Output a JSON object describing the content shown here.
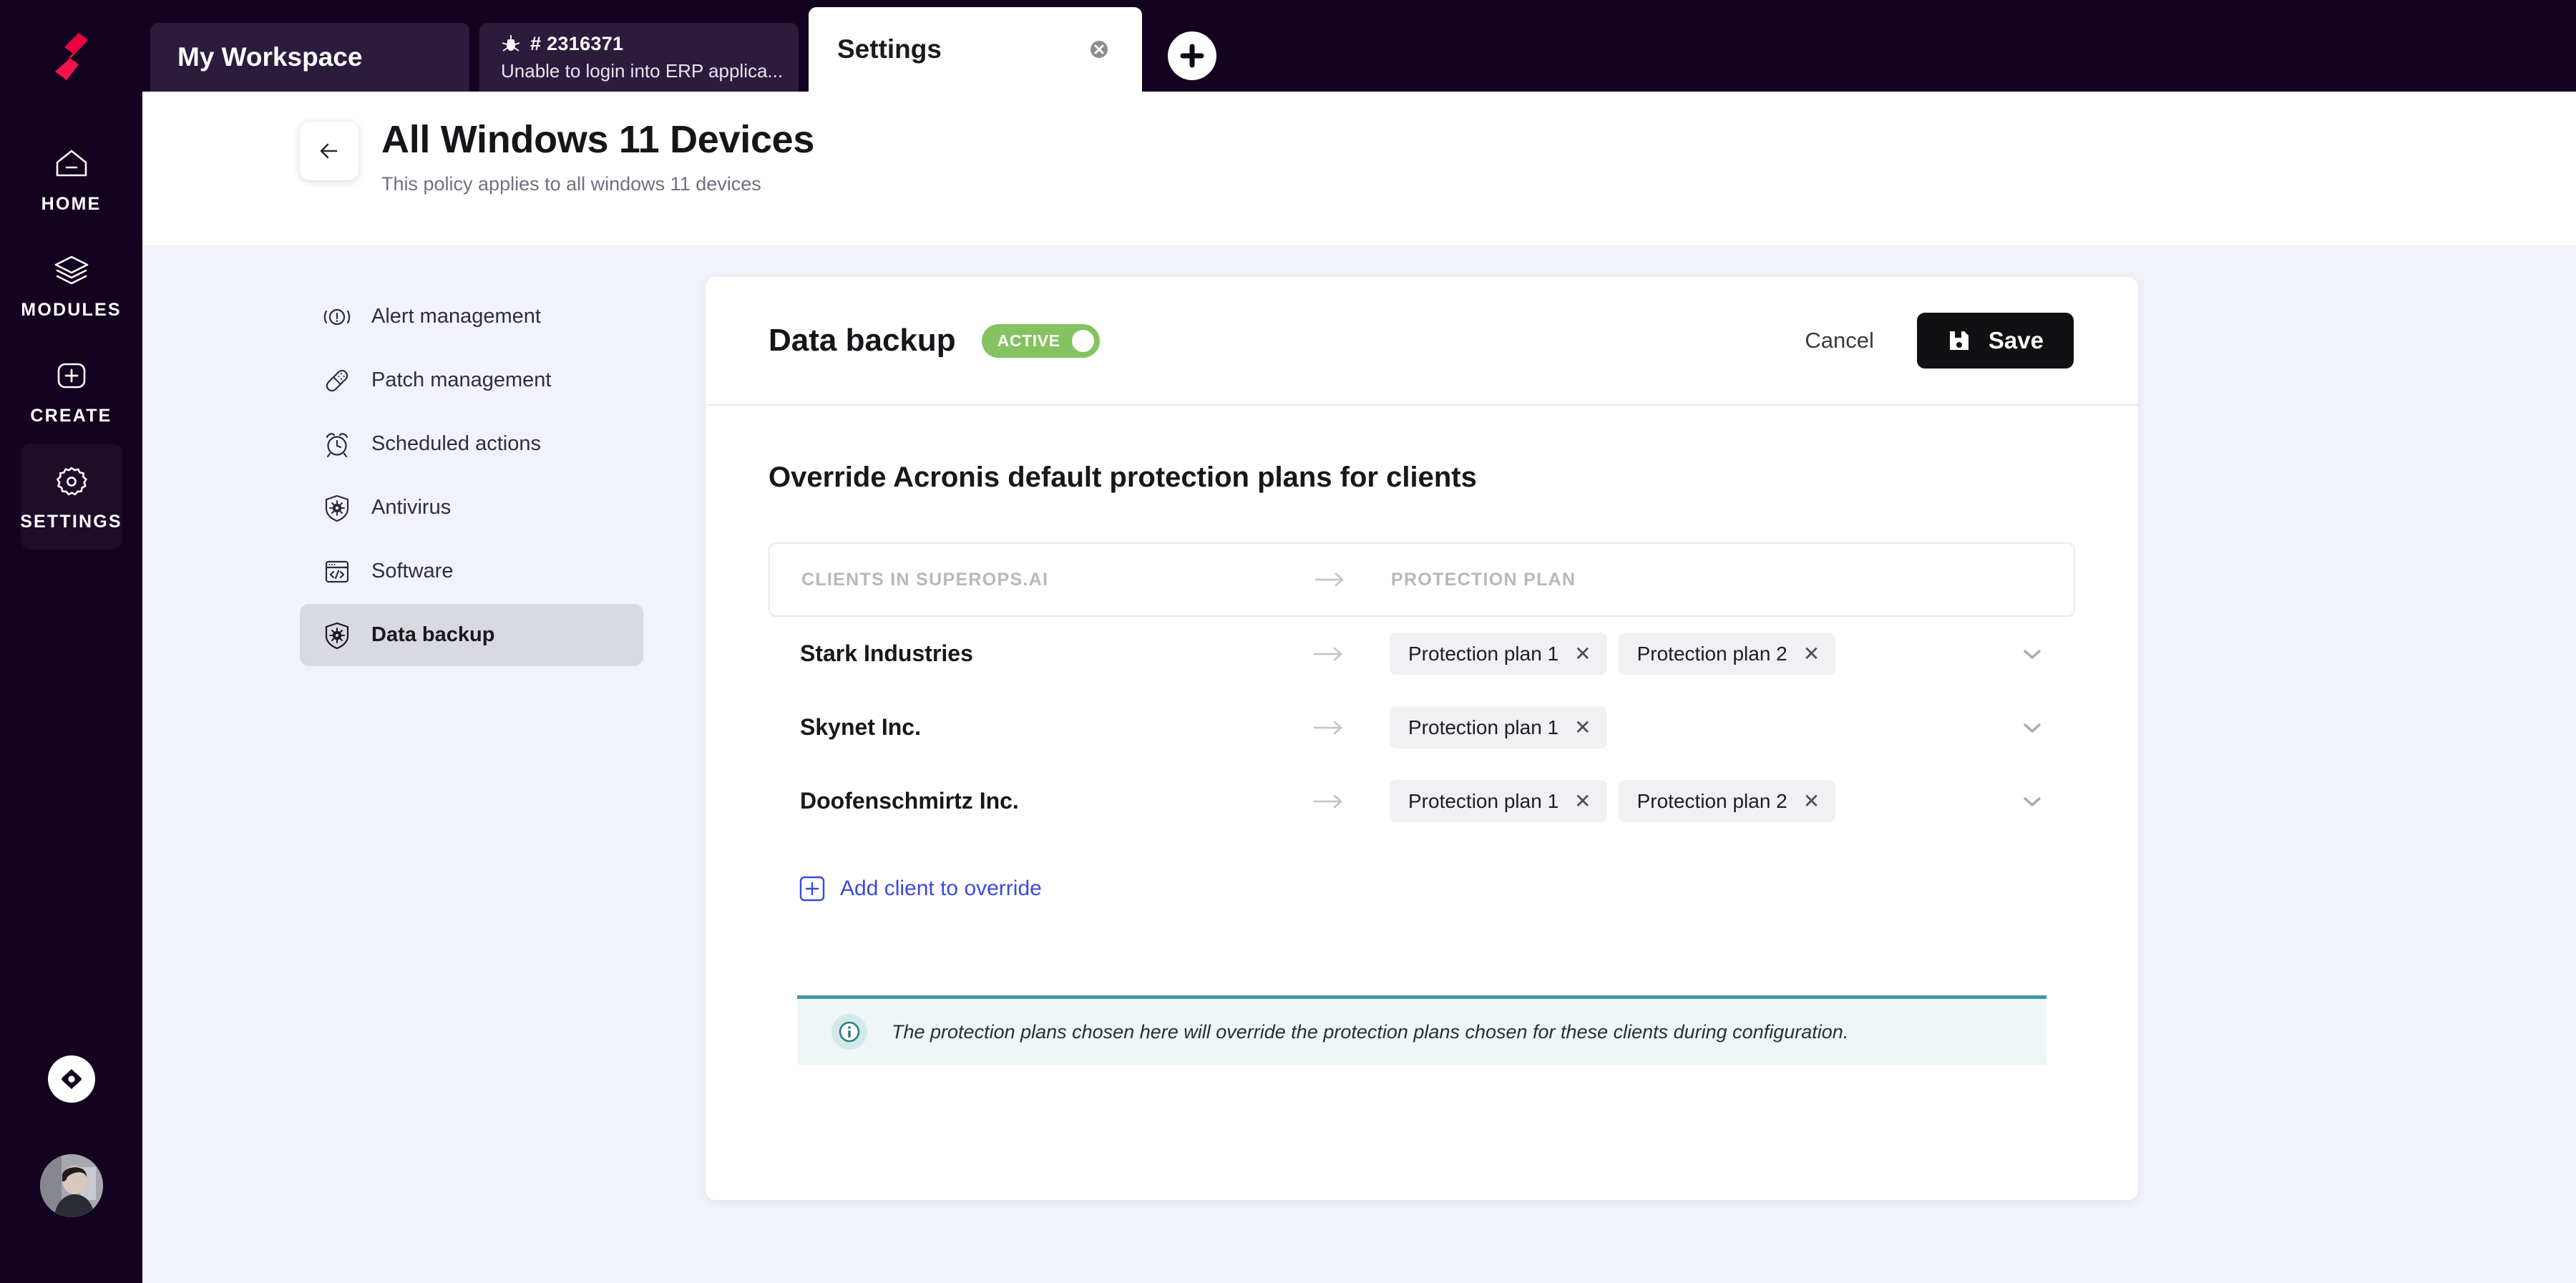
{
  "rail": {
    "logo_icon": "superops-logo-icon",
    "items": [
      {
        "label": "HOME",
        "icon": "home-icon",
        "active": false
      },
      {
        "label": "MODULES",
        "icon": "layers-icon",
        "active": false
      },
      {
        "label": "CREATE",
        "icon": "plus-square-icon",
        "active": false
      },
      {
        "label": "SETTINGS",
        "icon": "gear-icon",
        "active": true
      }
    ],
    "compass_icon": "compass-icon",
    "avatar_icon": "user-avatar"
  },
  "tabs": {
    "workspace": {
      "title": "My Workspace"
    },
    "ticket": {
      "icon": "bug-icon",
      "id": "# 2316371",
      "subject": "Unable to login into ERP applica..."
    },
    "settings": {
      "title": "Settings",
      "close_icon": "close-circle-icon"
    },
    "add_tab_icon": "plus-circle-icon"
  },
  "header": {
    "back_icon": "arrow-left-icon",
    "title": "All Windows 11 Devices",
    "subtitle": "This policy applies to all windows 11 devices"
  },
  "subnav": {
    "items": [
      {
        "label": "Alert management",
        "icon": "alert-circle-icon",
        "active": false
      },
      {
        "label": "Patch management",
        "icon": "bandage-icon",
        "active": false
      },
      {
        "label": "Scheduled actions",
        "icon": "alarm-clock-icon",
        "active": false
      },
      {
        "label": "Antivirus",
        "icon": "shield-virus-icon",
        "active": false
      },
      {
        "label": "Software",
        "icon": "code-window-icon",
        "active": false
      },
      {
        "label": "Data backup",
        "icon": "shield-virus-icon",
        "active": true
      }
    ]
  },
  "card": {
    "title": "Data backup",
    "status": {
      "label": "ACTIVE",
      "color": "#84c262"
    },
    "cancel_label": "Cancel",
    "save_label": "Save",
    "save_icon": "floppy-disk-icon",
    "section_title": "Override Acronis default protection plans for clients",
    "table": {
      "columns": [
        "CLIENTS IN SUPEROPS.AI",
        "PROTECTION PLAN"
      ],
      "arrow_icon": "arrow-right-icon",
      "chevron_icon": "chevron-down-icon",
      "rows": [
        {
          "client": "Stark Industries",
          "plans": [
            "Protection plan 1",
            "Protection plan 2"
          ]
        },
        {
          "client": "Skynet Inc.",
          "plans": [
            "Protection plan 1"
          ]
        },
        {
          "client": "Doofenschmirtz Inc.",
          "plans": [
            "Protection plan 1",
            "Protection plan 2"
          ]
        }
      ]
    },
    "add_client_label": "Add client to override",
    "add_client_icon": "plus-square-icon",
    "banner": {
      "icon": "info-circle-icon",
      "accent_color": "#3f9b9b",
      "text": "The protection plans chosen here will override the protection plans chosen for these clients during configuration."
    }
  }
}
